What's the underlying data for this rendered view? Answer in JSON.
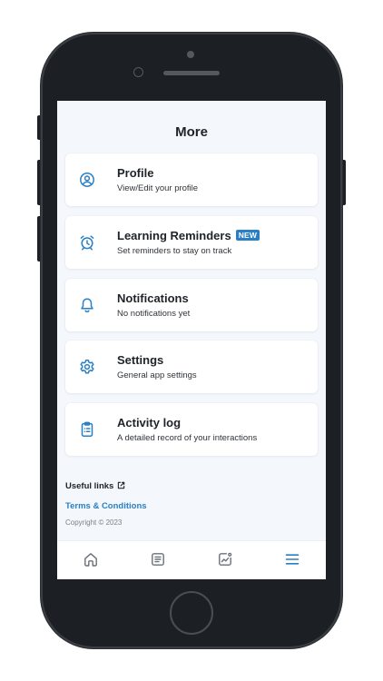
{
  "header": {
    "title": "More"
  },
  "menu": [
    {
      "title": "Profile",
      "subtitle": "View/Edit your profile",
      "icon": "profile-icon"
    },
    {
      "title": "Learning Reminders",
      "badge": "NEW",
      "subtitle": "Set reminders to stay on track",
      "icon": "alarm-clock-icon"
    },
    {
      "title": "Notifications",
      "subtitle": "No notifications yet",
      "icon": "bell-icon"
    },
    {
      "title": "Settings",
      "subtitle": "General app settings",
      "icon": "gear-icon"
    },
    {
      "title": "Activity log",
      "subtitle": "A detailed record of your interactions",
      "icon": "clipboard-list-icon"
    }
  ],
  "footer": {
    "useful_links_label": "Useful links",
    "terms_link": "Terms & Conditions",
    "copyright": "Copyright © 2023"
  },
  "nav": {
    "items": [
      "home-icon",
      "notes-icon",
      "stats-icon",
      "menu-icon"
    ],
    "active": "menu-icon"
  },
  "colors": {
    "accent": "#2a7fc4",
    "icon_inactive": "#6b7177",
    "screen_bg": "#f4f8fc",
    "card_bg": "#ffffff",
    "text": "#1f2328"
  }
}
